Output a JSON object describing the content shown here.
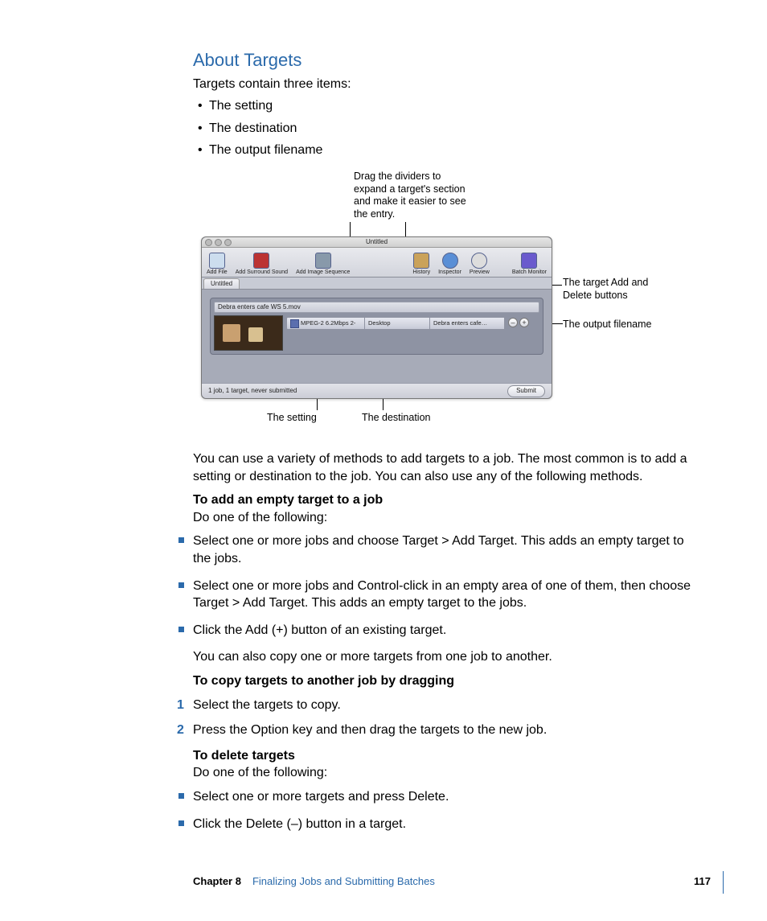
{
  "heading": "About Targets",
  "intro": "Targets contain three items:",
  "items": [
    "The setting",
    "The destination",
    "The output filename"
  ],
  "annotations": {
    "top": "Drag the dividers to expand a target's section and make it easier to see the entry.",
    "right1": "The target Add and Delete buttons",
    "right2": "The output filename",
    "bottom1": "The setting",
    "bottom2": "The destination"
  },
  "screenshot": {
    "window_title": "Untitled",
    "toolbar": {
      "add_file": "Add File",
      "add_surround": "Add Surround Sound",
      "add_image_seq": "Add Image Sequence",
      "history": "History",
      "inspector": "Inspector",
      "preview": "Preview",
      "batch_monitor": "Batch Monitor"
    },
    "tab": "Untitled",
    "job_title": "Debra enters cafe WS 5.mov",
    "setting_text": "MPEG-2 6.2Mbps 2-",
    "dest_text": "Desktop",
    "fname_text": "Debra enters cafe…",
    "status": "1 job, 1 target, never submitted",
    "submit": "Submit"
  },
  "body": {
    "p1": "You can use a variety of methods to add targets to a job. The most common is to add a setting or destination to the job. You can also use any of the following methods.",
    "h1": "To add an empty target to a job",
    "h1_sub": "Do one of the following:",
    "sq1": "Select one or more jobs and choose Target > Add Target. This adds an empty target to the jobs.",
    "sq2": "Select one or more jobs and Control-click in an empty area of one of them, then choose Target > Add Target. This adds an empty target to the jobs.",
    "sq3": "Click the Add (+) button of an existing target.",
    "p2": "You can also copy one or more targets from one job to another.",
    "h2": "To copy targets to another job by dragging",
    "n1": "Select the targets to copy.",
    "n2": "Press the Option key and then drag the targets to the new job.",
    "h3": "To delete targets",
    "h3_sub": "Do one of the following:",
    "sq4": "Select one or more targets and press Delete.",
    "sq5": "Click the Delete (–) button in a target."
  },
  "footer": {
    "chapter": "Chapter 8",
    "title": "Finalizing Jobs and Submitting Batches",
    "page": "117"
  }
}
